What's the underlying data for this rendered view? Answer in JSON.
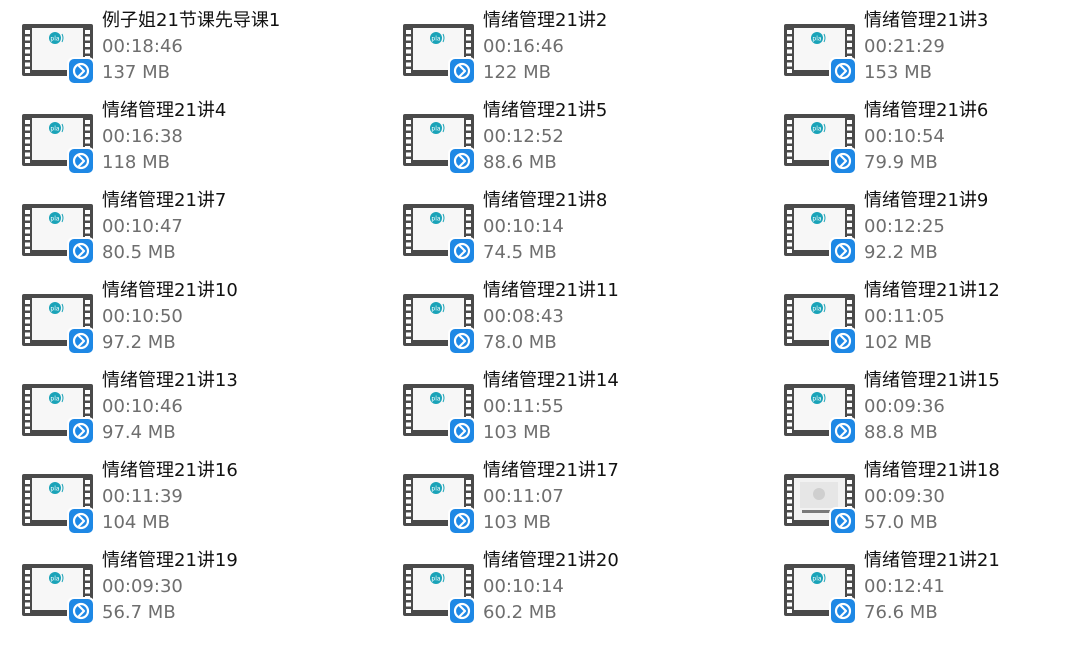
{
  "files": [
    {
      "name": "例子姐21节课先导课1",
      "duration": "00:18:46",
      "size": "137 MB",
      "thumb": "video"
    },
    {
      "name": "情绪管理21讲2",
      "duration": "00:16:46",
      "size": "122 MB",
      "thumb": "video"
    },
    {
      "name": "情绪管理21讲3",
      "duration": "00:21:29",
      "size": "153 MB",
      "thumb": "video"
    },
    {
      "name": "情绪管理21讲4",
      "duration": "00:16:38",
      "size": "118 MB",
      "thumb": "video"
    },
    {
      "name": "情绪管理21讲5",
      "duration": "00:12:52",
      "size": "88.6 MB",
      "thumb": "video"
    },
    {
      "name": "情绪管理21讲6",
      "duration": "00:10:54",
      "size": "79.9 MB",
      "thumb": "video"
    },
    {
      "name": "情绪管理21讲7",
      "duration": "00:10:47",
      "size": "80.5 MB",
      "thumb": "video"
    },
    {
      "name": "情绪管理21讲8",
      "duration": "00:10:14",
      "size": "74.5 MB",
      "thumb": "video"
    },
    {
      "name": "情绪管理21讲9",
      "duration": "00:12:25",
      "size": "92.2 MB",
      "thumb": "video"
    },
    {
      "name": "情绪管理21讲10",
      "duration": "00:10:50",
      "size": "97.2 MB",
      "thumb": "video"
    },
    {
      "name": "情绪管理21讲11",
      "duration": "00:08:43",
      "size": "78.0 MB",
      "thumb": "video"
    },
    {
      "name": "情绪管理21讲12",
      "duration": "00:11:05",
      "size": "102 MB",
      "thumb": "video"
    },
    {
      "name": "情绪管理21讲13",
      "duration": "00:10:46",
      "size": "97.4 MB",
      "thumb": "video"
    },
    {
      "name": "情绪管理21讲14",
      "duration": "00:11:55",
      "size": "103 MB",
      "thumb": "video"
    },
    {
      "name": "情绪管理21讲15",
      "duration": "00:09:36",
      "size": "88.8 MB",
      "thumb": "video"
    },
    {
      "name": "情绪管理21讲16",
      "duration": "00:11:39",
      "size": "104 MB",
      "thumb": "video"
    },
    {
      "name": "情绪管理21讲17",
      "duration": "00:11:07",
      "size": "103 MB",
      "thumb": "video"
    },
    {
      "name": "情绪管理21讲18",
      "duration": "00:09:30",
      "size": "57.0 MB",
      "thumb": "video-alt"
    },
    {
      "name": "情绪管理21讲19",
      "duration": "00:09:30",
      "size": "56.7 MB",
      "thumb": "video"
    },
    {
      "name": "情绪管理21讲20",
      "duration": "00:10:14",
      "size": "60.2 MB",
      "thumb": "video"
    },
    {
      "name": "情绪管理21讲21",
      "duration": "00:12:41",
      "size": "76.6 MB",
      "thumb": "video"
    }
  ],
  "colors": {
    "player_badge": "#1e88e5",
    "film_frame": "#4a4a4a",
    "thumb_logo": "#1aa3b8"
  }
}
